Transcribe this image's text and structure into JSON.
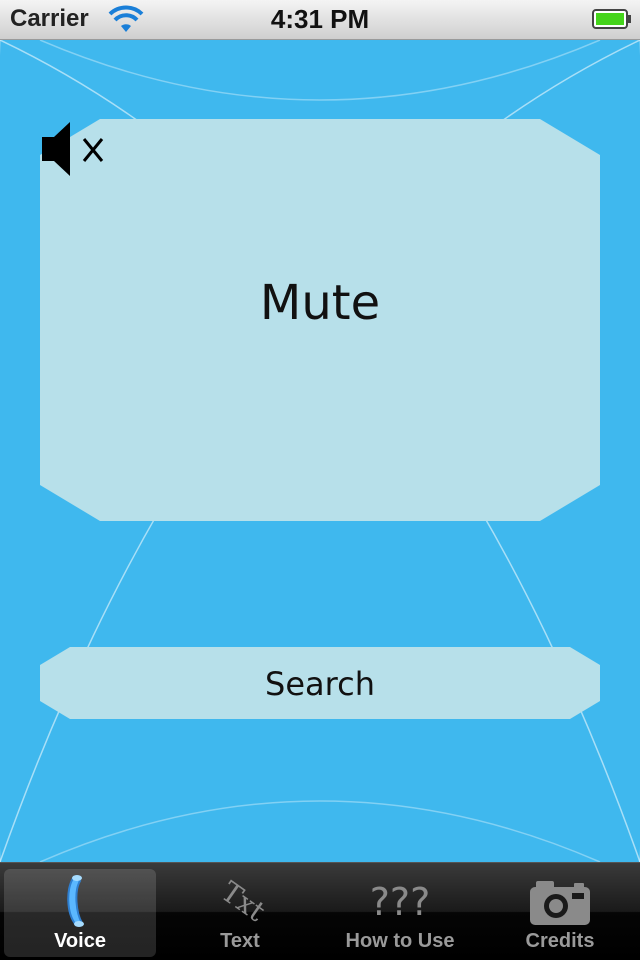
{
  "status_bar": {
    "carrier": "Carrier",
    "time": "4:31 PM"
  },
  "main": {
    "background_color": "#3fb8ee",
    "panel_color": "#b7e0ea",
    "mute_label": "Mute",
    "search_label": "Search"
  },
  "tabs": [
    {
      "label": "Voice",
      "icon": "phone-handset-icon",
      "active": true
    },
    {
      "label": "Text",
      "icon": "txt-icon",
      "icon_text": "Txt",
      "active": false
    },
    {
      "label": "How to Use",
      "icon": "question-marks-icon",
      "icon_text": "???",
      "active": false
    },
    {
      "label": "Credits",
      "icon": "camera-icon",
      "active": false
    }
  ]
}
